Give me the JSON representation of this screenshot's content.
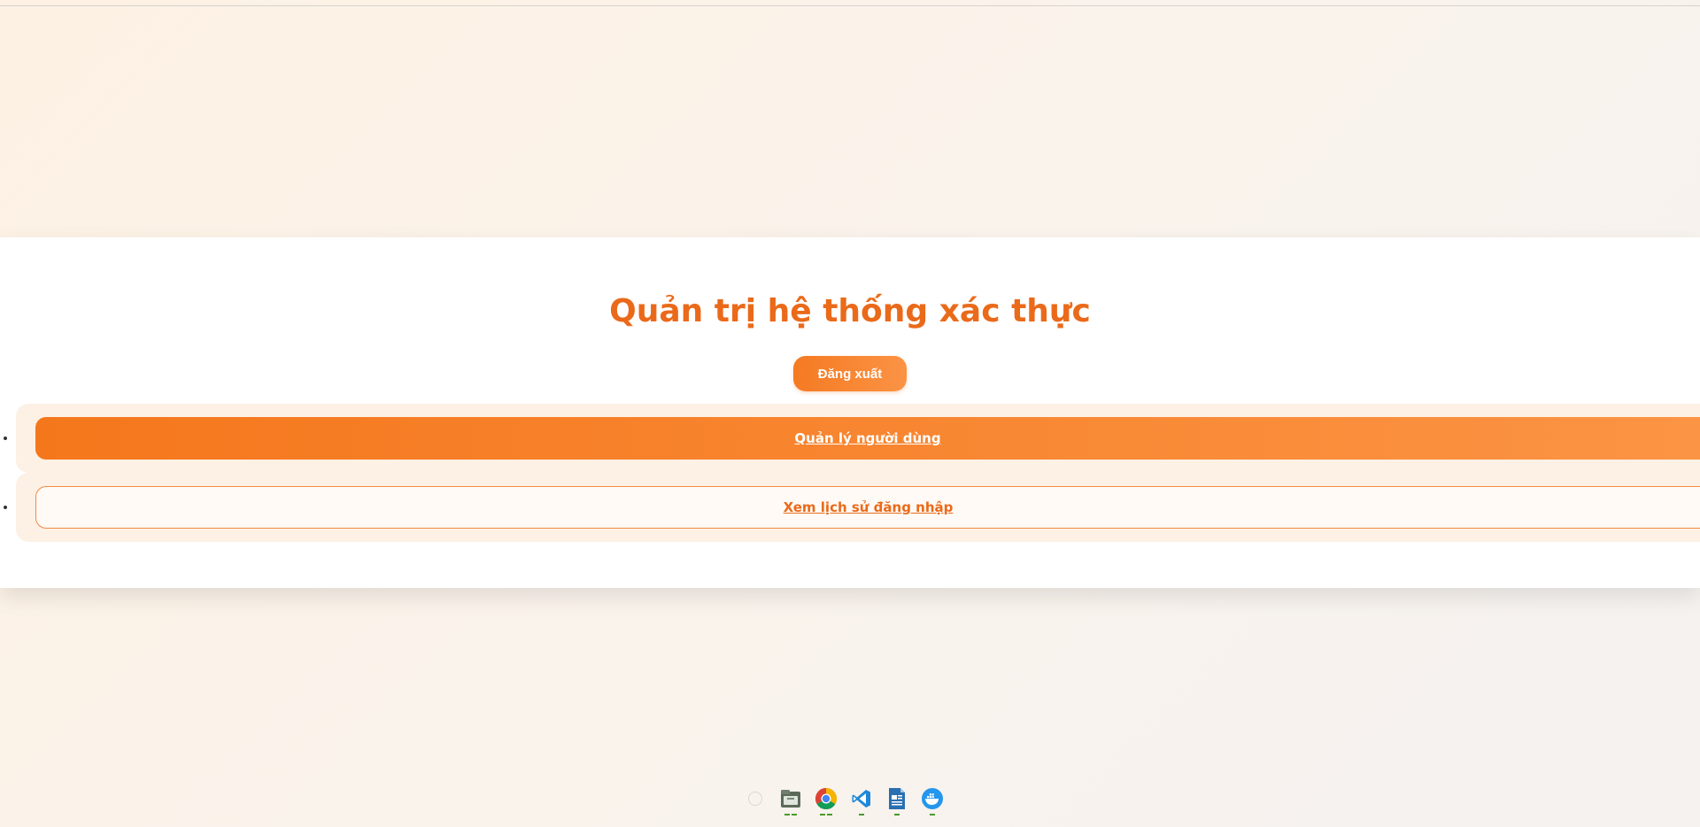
{
  "page": {
    "title": "Quản trị hệ thống xác thực"
  },
  "header": {
    "logout_label": "Đăng xuất"
  },
  "nav": {
    "items": [
      {
        "label": "Quản lý người dùng",
        "style": "primary"
      },
      {
        "label": "Xem lịch sử đăng nhập",
        "style": "secondary"
      }
    ]
  },
  "dock": {
    "apps": [
      {
        "name": "launcher-icon",
        "running": false
      },
      {
        "name": "files-icon",
        "running": true
      },
      {
        "name": "chrome-icon",
        "running": true
      },
      {
        "name": "vscode-icon",
        "running": true
      },
      {
        "name": "libreoffice-writer-icon",
        "running": true
      },
      {
        "name": "docker-icon",
        "running": true
      }
    ]
  },
  "colors": {
    "accent": "#ea6a1a",
    "button_gradient_start": "#f5771c",
    "button_gradient_end": "#fb9444",
    "nav_item_bg": "#fcf1e4"
  }
}
